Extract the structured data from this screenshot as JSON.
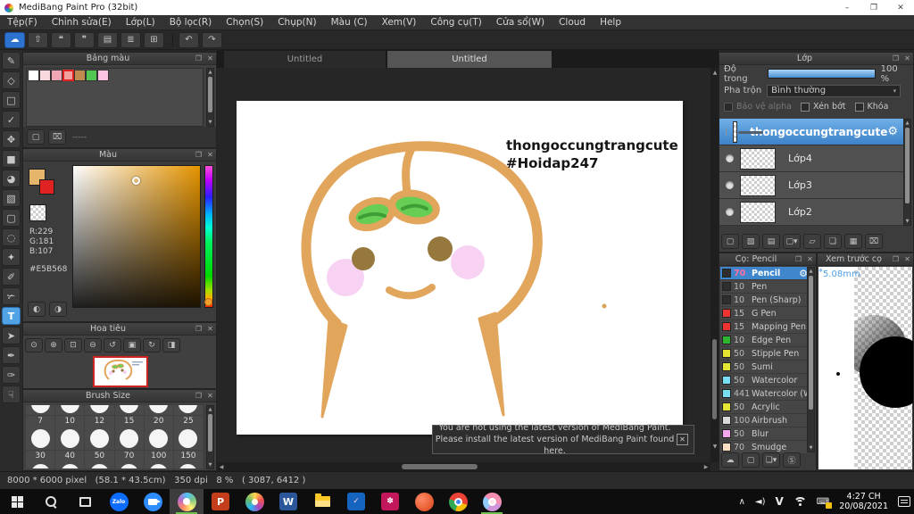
{
  "window": {
    "title": "MediBang Paint Pro (32bit)"
  },
  "icons": {
    "minimize": "–",
    "restore": "❐",
    "close": "✕",
    "undo": "↶",
    "redo": "↷",
    "panel_popup": "❐",
    "panel_close": "✕",
    "dropdown": "▾",
    "gear": "⚙",
    "separator_dashes": "-----",
    "scroll_up": "▲",
    "scroll_down": "▼",
    "scroll_left": "◀",
    "scroll_right": "▶",
    "new_doc": "▢",
    "trash": "⌧",
    "palette_left": "◐",
    "palette_right": "◑",
    "preview_pin": "✱",
    "tray_chevron": "∧",
    "volume": "◄)",
    "toast_close": "✕"
  },
  "menu": {
    "items": [
      "Tệp(F)",
      "Chỉnh sửa(E)",
      "Lớp(L)",
      "Bộ lọc(R)",
      "Chọn(S)",
      "Chụp(N)",
      "Màu (C)",
      "Xem(V)",
      "Công cụ(T)",
      "Cửa sổ(W)",
      "Cloud",
      "Help"
    ]
  },
  "toolbar": {
    "buttons": [
      {
        "name": "cloud-button",
        "glyph": "☁",
        "primary": true
      },
      {
        "name": "publish-button",
        "glyph": "⇧"
      },
      {
        "name": "comment-button",
        "glyph": "❝"
      },
      {
        "name": "message-button",
        "glyph": "❞"
      },
      {
        "name": "document-button",
        "glyph": "▤"
      },
      {
        "name": "list-button",
        "glyph": "≣"
      },
      {
        "name": "grid-button",
        "glyph": "⊞"
      }
    ]
  },
  "tools": [
    {
      "name": "brush-tool",
      "glyph": "✎"
    },
    {
      "name": "eraser-tool",
      "glyph": "◇"
    },
    {
      "name": "figure-tool",
      "glyph": "□"
    },
    {
      "name": "curve-tool",
      "glyph": "✓"
    },
    {
      "name": "move-tool",
      "glyph": "✥"
    },
    {
      "name": "fill-rect-tool",
      "glyph": "■"
    },
    {
      "name": "bucket-tool",
      "glyph": "◕"
    },
    {
      "name": "gradient-tool",
      "glyph": "▧"
    },
    {
      "name": "select-rect-tool",
      "glyph": "▢"
    },
    {
      "name": "lasso-tool",
      "glyph": "◌"
    },
    {
      "name": "magic-wand-tool",
      "glyph": "✦"
    },
    {
      "name": "select-pen-tool",
      "glyph": "✐"
    },
    {
      "name": "select-eraser-tool",
      "glyph": "✃"
    },
    {
      "name": "text-tool",
      "glyph": "T",
      "selected": true
    },
    {
      "name": "operation-tool",
      "glyph": "➤"
    },
    {
      "name": "eyedropper-tool",
      "glyph": "✒"
    },
    {
      "name": "divide-tool",
      "glyph": "✑"
    },
    {
      "name": "hand-tool",
      "glyph": "☟"
    }
  ],
  "tabs": {
    "tab1": "Untitled",
    "tab2": "Untitled"
  },
  "palette_panel": {
    "title": "Bảng màu",
    "swatches": [
      {
        "color": "#ffffff"
      },
      {
        "color": "#f7d9de"
      },
      {
        "color": "#f1a6b6"
      },
      {
        "color": "#f2a09e",
        "selected": true
      },
      {
        "color": "#c08b4e"
      },
      {
        "color": "#52c852"
      },
      {
        "color": "#fac4e0"
      }
    ]
  },
  "color_panel": {
    "title": "Màu",
    "r": "R:229",
    "g": "G:181",
    "b": "B:107",
    "hex": "#E5B568",
    "foreground": "#E5B56B",
    "secondary": "#E02222"
  },
  "navigator_panel": {
    "title": "Hoa tiêu",
    "buttons": [
      {
        "name": "zoom-100-button",
        "glyph": "⊙"
      },
      {
        "name": "zoom-in-button",
        "glyph": "⊕"
      },
      {
        "name": "fit-screen-button",
        "glyph": "⊡"
      },
      {
        "name": "zoom-out-button",
        "glyph": "⊖"
      },
      {
        "name": "rotate-left-button",
        "glyph": "↺"
      },
      {
        "name": "reset-view-button",
        "glyph": "▣"
      },
      {
        "name": "rotate-right-button",
        "glyph": "↻"
      },
      {
        "name": "flip-button",
        "glyph": "◨"
      }
    ]
  },
  "brush_size_panel": {
    "title": "Brush Size",
    "row1": [
      "7",
      "10",
      "12",
      "15",
      "20",
      "25"
    ],
    "row2": [
      "30",
      "40",
      "50",
      "70",
      "100",
      "150"
    ]
  },
  "canvas": {
    "text_line1": "thongoccungtrangcute",
    "text_line2": "#Hoidap247"
  },
  "notification": {
    "line1": "You are not using the latest version of MediBang Paint.",
    "line2": "Please install the latest version of MediBang Paint found here."
  },
  "layers_panel": {
    "title": "Lớp",
    "opacity_label": "Độ trong",
    "opacity_value": "100 %",
    "blend_label": "Pha trộn",
    "blend_value": "Bình thường",
    "check1": "Bảo vệ alpha",
    "check2": "Xén bớt",
    "check3": "Khóa",
    "layers": [
      {
        "name": "thongoccungtrangcute",
        "selected": true
      },
      {
        "name": "Lớp4"
      },
      {
        "name": "Lớp3"
      },
      {
        "name": "Lớp2"
      }
    ],
    "buttons": [
      {
        "name": "add-layer-button",
        "glyph": "▢"
      },
      {
        "name": "add-8bit-layer-button",
        "glyph": "▧"
      },
      {
        "name": "add-1bit-layer-button",
        "glyph": "▤"
      },
      {
        "name": "add-layer-menu-button",
        "glyph": "▢▾"
      },
      {
        "name": "layer-folder-button",
        "glyph": "▱"
      },
      {
        "name": "duplicate-layer-button",
        "glyph": "❏"
      },
      {
        "name": "merge-layer-button",
        "glyph": "▦"
      },
      {
        "name": "delete-layer-button",
        "glyph": "⌧"
      }
    ]
  },
  "brush_panel": {
    "title": "Cọ: Pencil",
    "brushes": [
      {
        "size": "70",
        "name": "Pencil",
        "color": "#2e2e2e",
        "selected": true
      },
      {
        "size": "10",
        "name": "Pen",
        "color": "#2e2e2e"
      },
      {
        "size": "10",
        "name": "Pen (Sharp)",
        "color": "#2e2e2e"
      },
      {
        "size": "15",
        "name": "G Pen",
        "color": "#ee3333"
      },
      {
        "size": "15",
        "name": "Mapping Pen",
        "color": "#ee3333"
      },
      {
        "size": "10",
        "name": "Edge Pen",
        "color": "#2db52d"
      },
      {
        "size": "50",
        "name": "Stipple Pen",
        "color": "#e5e533"
      },
      {
        "size": "50",
        "name": "Sumi",
        "color": "#e5e533"
      },
      {
        "size": "50",
        "name": "Watercolor",
        "color": "#77dff0"
      },
      {
        "size": "441",
        "name": "Watercolor (W",
        "color": "#77dff0"
      },
      {
        "size": "50",
        "name": "Acrylic",
        "color": "#e5e533"
      },
      {
        "size": "100",
        "name": "Airbrush",
        "color": "#d9d9d9"
      },
      {
        "size": "50",
        "name": "Blur",
        "color": "#f2a6ec"
      },
      {
        "size": "70",
        "name": "Smudge",
        "color": "#fbdfc4"
      }
    ],
    "buttons": [
      {
        "name": "cloud-brush-button",
        "glyph": "☁"
      },
      {
        "name": "add-brush-button",
        "glyph": "▢"
      },
      {
        "name": "brush-image-button",
        "glyph": "❏▾"
      },
      {
        "name": "brush-script-button",
        "glyph": "Ⓢ"
      }
    ]
  },
  "preview_panel": {
    "title": "Xem trước cọ",
    "size": "5.08mm"
  },
  "status_bar": {
    "text": "8000 * 6000 pixel   (58.1 * 43.5cm)   350 dpi   8 %   ( 3087, 6412 )"
  },
  "taskbar": {
    "zalo": "Zalo",
    "powerpoint": "P",
    "word": "W",
    "input": "V",
    "time": "4:27 CH",
    "date": "20/08/2021"
  }
}
